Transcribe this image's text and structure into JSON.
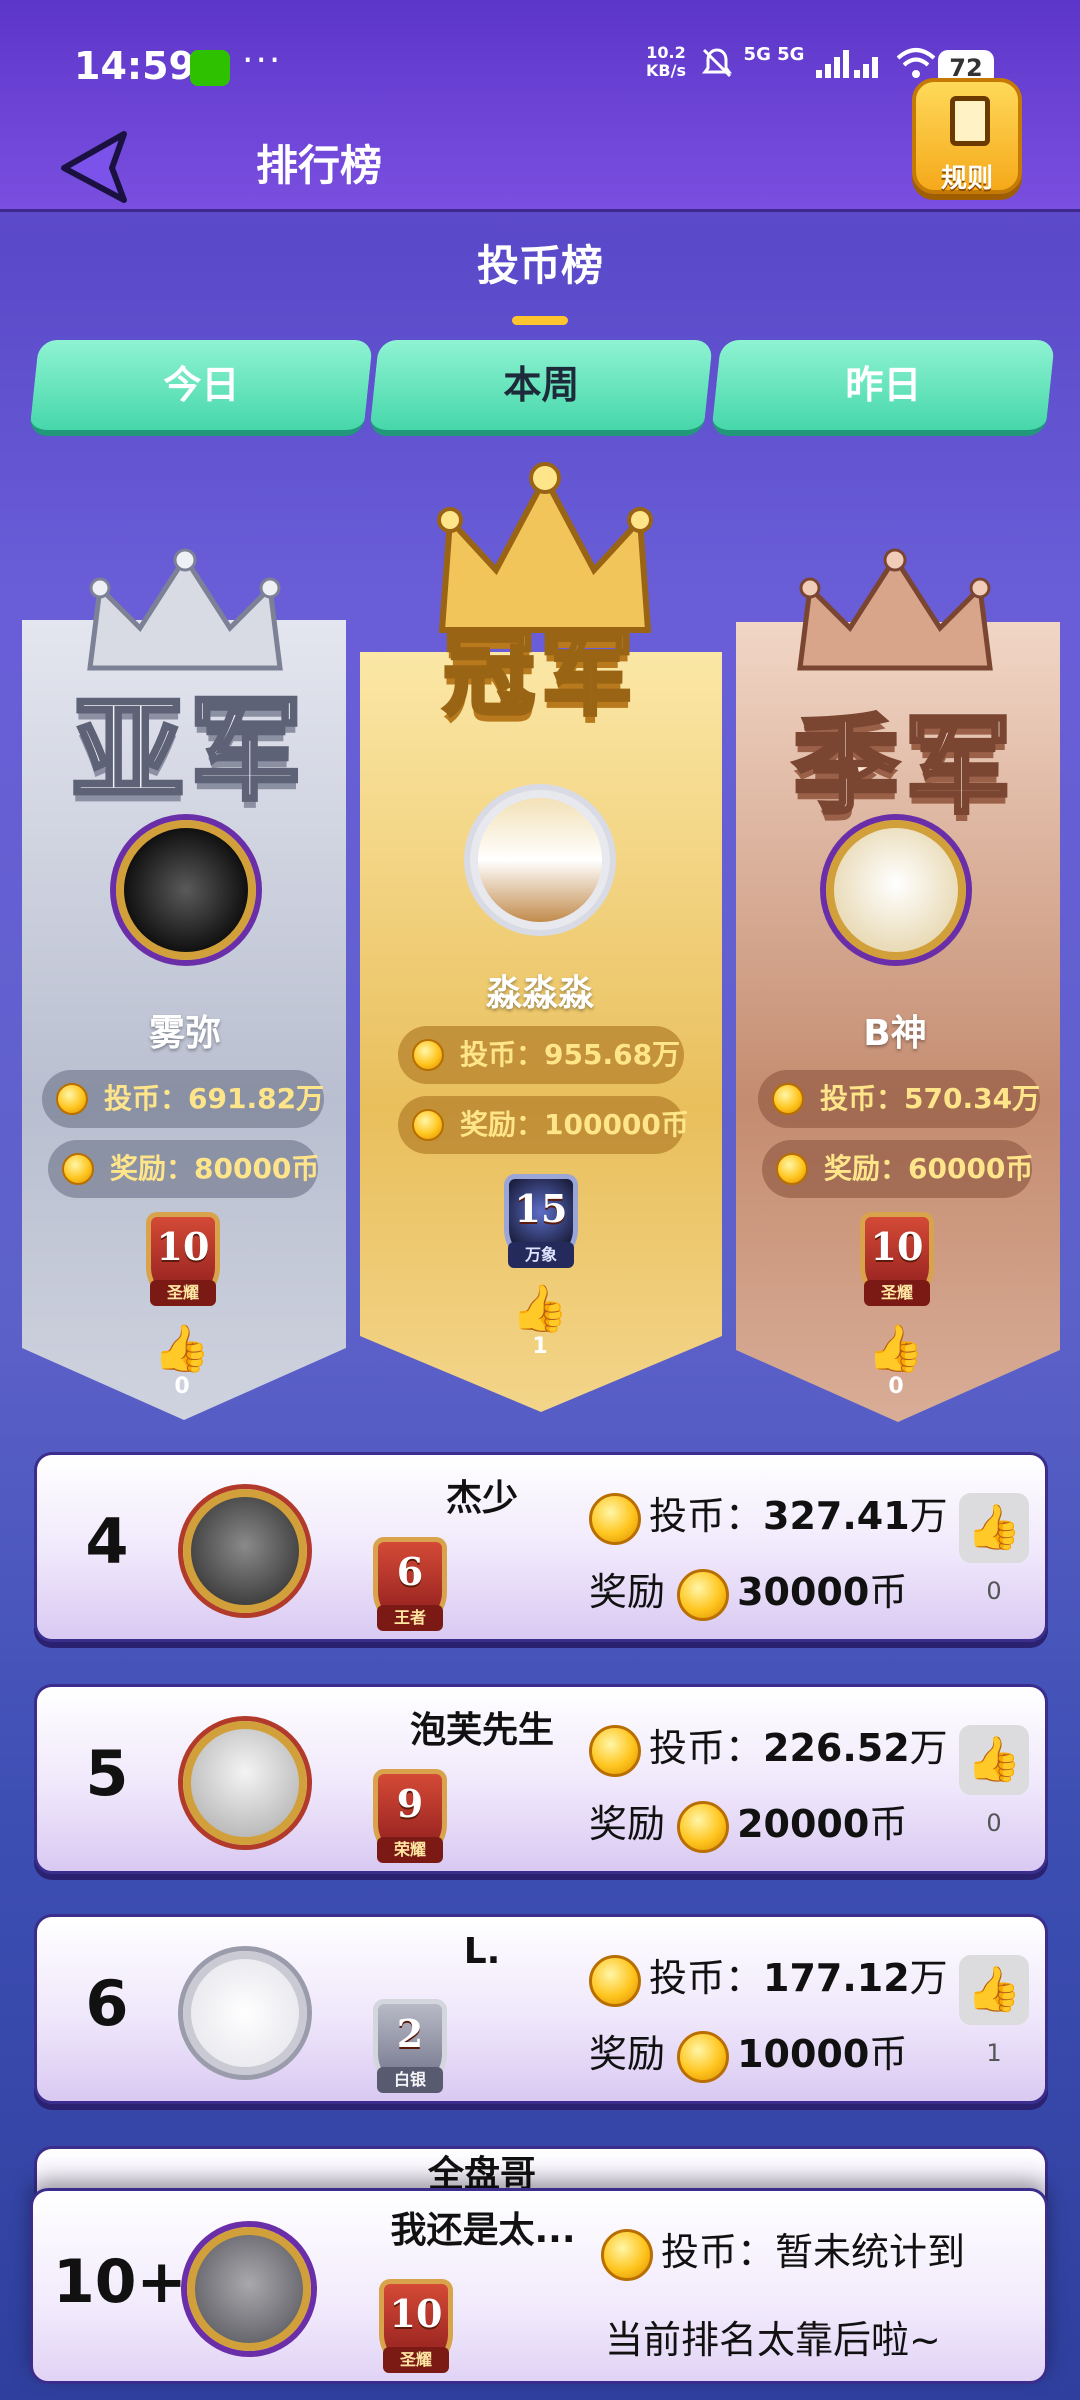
{
  "status_bar": {
    "time": "14:59",
    "dots": "···",
    "net_speed": "10.2",
    "net_unit": "KB/s",
    "signal": "5G 5G",
    "battery": "72"
  },
  "header": {
    "title": "排行榜",
    "rules_label": "规则"
  },
  "board": {
    "title": "投币榜",
    "tabs": [
      {
        "label": "今日",
        "active": false
      },
      {
        "label": "本周",
        "active": true
      },
      {
        "label": "昨日",
        "active": false
      }
    ]
  },
  "podium": {
    "second": {
      "rank_word": "亚军",
      "name": "雾弥",
      "coins": "投币：691.82万",
      "reward": "奖励：80000币",
      "badge_num": "10",
      "badge_tier": "圣耀",
      "likes": "0"
    },
    "first": {
      "rank_word": "冠军",
      "name": "淼淼淼",
      "coins": "投币：955.68万",
      "reward": "奖励：100000币",
      "badge_num": "15",
      "badge_tier": "万象",
      "likes": "1"
    },
    "third": {
      "rank_word": "季军",
      "name": "B神",
      "coins": "投币：570.34万",
      "reward": "奖励：60000币",
      "badge_num": "10",
      "badge_tier": "圣耀",
      "likes": "0"
    }
  },
  "list": [
    {
      "rank": "4",
      "name": "杰少",
      "coin_label": "投币：",
      "coin_value": "327.41",
      "coin_unit": "万",
      "reward_label": "奖励",
      "reward_value": "30000",
      "reward_unit": "币",
      "badge_num": "6",
      "badge_tier": "王者",
      "likes": "0"
    },
    {
      "rank": "5",
      "name": "泡芙先生",
      "coin_label": "投币：",
      "coin_value": "226.52",
      "coin_unit": "万",
      "reward_label": "奖励",
      "reward_value": "20000",
      "reward_unit": "币",
      "badge_num": "9",
      "badge_tier": "荣耀",
      "likes": "0"
    },
    {
      "rank": "6",
      "name": "L.",
      "coin_label": "投币：",
      "coin_value": "177.12",
      "coin_unit": "万",
      "reward_label": "奖励",
      "reward_value": "10000",
      "reward_unit": "币",
      "badge_num": "2",
      "badge_tier": "白银",
      "likes": "1"
    }
  ],
  "partial_row": {
    "name": "全盘哥"
  },
  "my_rank": {
    "rank": "10+",
    "name": "我还是太...",
    "coins": "投币：暂未统计到",
    "note": "当前排名太靠后啦~",
    "badge_num": "10",
    "badge_tier": "圣耀"
  },
  "colors": {
    "accent_tab": "#46d7aa",
    "gold": "#ffc51e",
    "background": "#5c61c9"
  },
  "icons": [
    "back-arrow-icon",
    "rules-document-icon",
    "coin-icon",
    "thumbs-up-icon",
    "crown-icon",
    "level-badge-icon"
  ]
}
